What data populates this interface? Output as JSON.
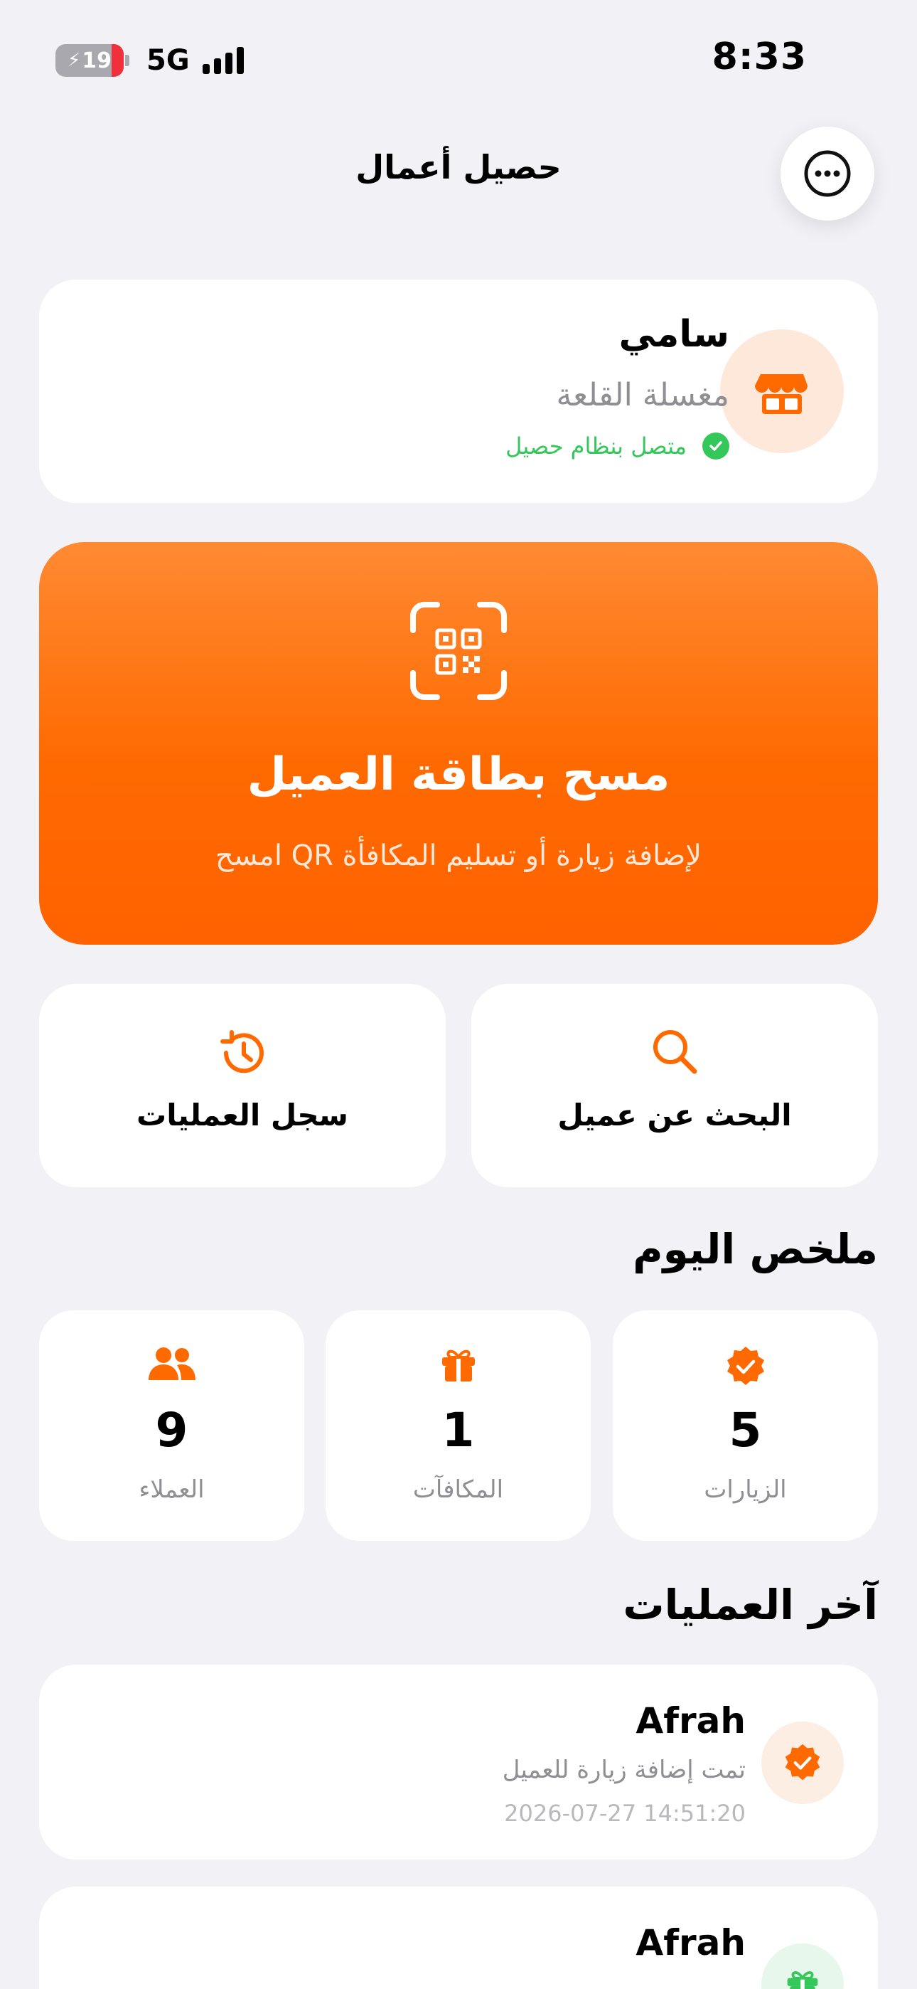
{
  "status_bar": {
    "time": "8:33",
    "battery": "19",
    "network": "5G"
  },
  "header": {
    "title": "حصيل أعمال",
    "more_icon": "ellipsis-circle-icon"
  },
  "profile": {
    "owner_name": "سامي",
    "shop_name": "مغسلة القلعة",
    "connection_status": "متصل بنظام حصيل",
    "avatar_icon": "store-icon"
  },
  "scan": {
    "title": "مسح بطاقة العميل",
    "subtitle": "امسح QR لإضافة زيارة أو تسليم المكافأة",
    "icon": "qr-scan-icon"
  },
  "actions": {
    "search_label": "البحث عن عميل",
    "history_label": "سجل العمليات"
  },
  "summary": {
    "title": "ملخص اليوم",
    "stats": [
      {
        "label": "الزيارات",
        "value": "5",
        "icon": "verified-badge-icon"
      },
      {
        "label": "المكافآت",
        "value": "1",
        "icon": "gift-icon"
      },
      {
        "label": "العملاء",
        "value": "9",
        "icon": "users-icon"
      }
    ]
  },
  "recent": {
    "title": "آخر العمليات",
    "items": [
      {
        "name": "Afrah",
        "description": "تمت إضافة زيارة للعميل",
        "timestamp": "2026-07-27 14:51:20",
        "icon": "verified-badge-icon"
      },
      {
        "name": "Afrah",
        "icon": "gift-icon"
      }
    ]
  },
  "colors": {
    "accent": "#FF6A00",
    "success": "#34C759",
    "background": "#F2F2F6"
  }
}
